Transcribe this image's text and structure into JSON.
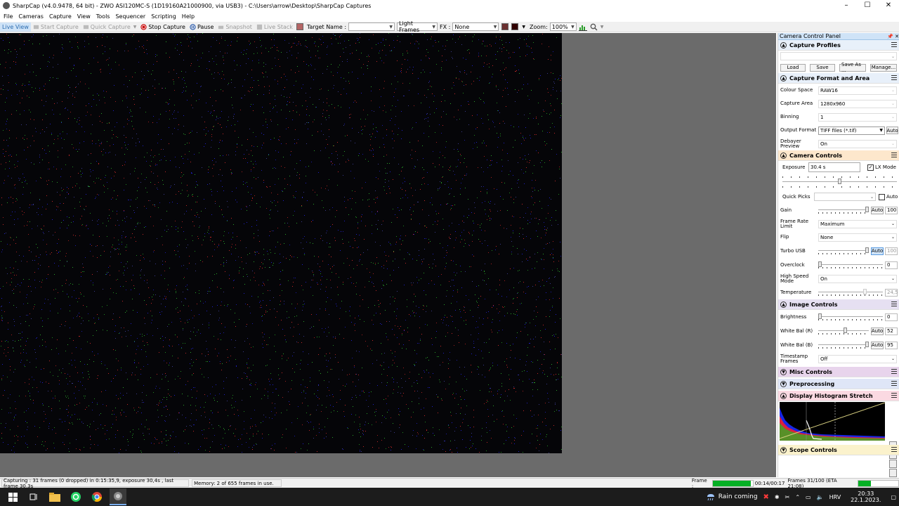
{
  "window": {
    "title": "SharpCap (v4.0.9478, 64 bit) - ZWO ASI120MC-S (1D19160A21000900, via USB3) - C:\\Users\\arrow\\Desktop\\SharpCap Captures",
    "controls": {
      "minimize": "–",
      "maximize": "☐",
      "close": "✕"
    }
  },
  "menu": [
    "File",
    "Cameras",
    "Capture",
    "View",
    "Tools",
    "Sequencer",
    "Scripting",
    "Help"
  ],
  "toolbar": {
    "live_view": "Live View",
    "start_capture": "Start Capture",
    "quick_capture": "Quick Capture",
    "stop_capture": "Stop Capture",
    "pause": "Pause",
    "snapshot": "Snapshot",
    "live_stack": "Live Stack",
    "target_name_label": "Target Name :",
    "target_name_value": "",
    "frame_type": "Light Frames",
    "fx_label": "FX :",
    "fx_value": "None",
    "zoom_label": "Zoom:",
    "zoom_value": "100%"
  },
  "panel": {
    "title": "Camera Control Panel",
    "pin": "📌 ✕",
    "capture_profiles": {
      "title": "Capture Profiles",
      "selected": "",
      "buttons": [
        "Load",
        "Save",
        "Save As ...",
        "Manage..."
      ]
    },
    "capture_format": {
      "title": "Capture Format and Area",
      "colour_space_label": "Colour Space",
      "colour_space": "RAW16",
      "capture_area_label": "Capture Area",
      "capture_area": "1280x960",
      "binning_label": "Binning",
      "binning": "1",
      "output_format_label": "Output Format",
      "output_format": "TIFF files (*.tif)",
      "output_auto": "Auto",
      "debayer_label": "Debayer Preview",
      "debayer": "On"
    },
    "camera_controls": {
      "title": "Camera Controls",
      "exposure_label": "Exposure",
      "exposure": "30.4 s",
      "lx_mode_label": "LX Mode",
      "lx_mode": true,
      "quick_picks_label": "Quick Picks",
      "quick_picks_auto": "Auto",
      "gain_label": "Gain",
      "gain_auto": "Auto",
      "gain": "100",
      "gain_level": 1.0,
      "frame_rate_label": "Frame Rate Limit",
      "frame_rate": "Maximum",
      "flip_label": "Flip",
      "flip": "None",
      "turbo_label": "Turbo USB",
      "turbo_auto": "Auto",
      "turbo": "100",
      "overclock_label": "Overclock",
      "overclock": "0",
      "high_speed_label": "High Speed Mode",
      "high_speed": "On",
      "temperature_label": "Temperature",
      "temperature": "24,5"
    },
    "image_controls": {
      "title": "Image Controls",
      "brightness_label": "Brightness",
      "brightness": "0",
      "wb_r_label": "White Bal (R)",
      "wb_r_auto": "Auto",
      "wb_r": "52",
      "wb_b_label": "White Bal (B)",
      "wb_b_auto": "Auto",
      "wb_b": "95",
      "timestamp_label": "Timestamp Frames",
      "timestamp": "Off"
    },
    "misc_controls": "Misc Controls",
    "preprocessing": "Preprocessing",
    "histogram": "Display Histogram Stretch",
    "scope_controls": "Scope Controls"
  },
  "status": {
    "capturing": "Capturing : 31 frames (0 dropped) in 0:15:35,9, exposure 30,4s , last frame 30,3s",
    "memory": "Memory: 2 of 655 frames in use.",
    "frame_label": "Frame :",
    "frame_progress": 0.95,
    "elapsed": "00:14/00:17",
    "frames": "Frames 31/100 (ETA 21:08)",
    "frames_progress": 0.31
  },
  "taskbar": {
    "weather": "Rain coming",
    "language": "HRV",
    "time": "20:33",
    "date": "22.1.2023."
  },
  "colors": {
    "accent": "#cfe3f7",
    "progress": "#06b025",
    "stop": "#cc0000"
  }
}
